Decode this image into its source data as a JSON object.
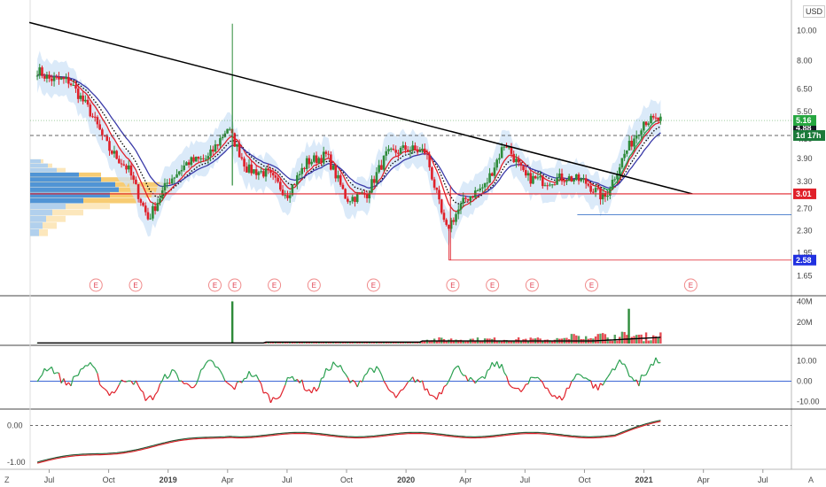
{
  "currency": "USD",
  "corner_left": "Z",
  "corner_right": "A",
  "price_tags": [
    {
      "label": "4.88",
      "value": 4.88,
      "bg": "#131722",
      "fg": "#ffffff"
    },
    {
      "label": "5.16",
      "value": 5.16,
      "bg": "#26a640",
      "fg": "#ffffff"
    },
    {
      "label": "1d 17h",
      "value": 4.62,
      "bg": "#1b7a3a",
      "fg": "#ffffff"
    },
    {
      "label": "3.01",
      "value": 3.01,
      "bg": "#e0202a",
      "fg": "#ffffff"
    },
    {
      "label": "2.58",
      "value": 1.85,
      "bg": "#2030e0",
      "fg": "#ffffff"
    }
  ],
  "earnings_marker": "E",
  "colors": {
    "up": "#2e8b3a",
    "down": "#e0202a",
    "ema_fast": "#e0202a",
    "ema_slow": "#3a3aa8",
    "band": "#cfe3f7",
    "trend": "#000000",
    "support": "#e0202a",
    "ma_green": "#2aa050"
  },
  "chart_data": [
    {
      "type": "candlestick",
      "ylabel": "",
      "scale": "log",
      "y_ticks": [
        "10.00",
        "8.00",
        "6.50",
        "5.50",
        "4.50",
        "3.90",
        "3.30",
        "2.70",
        "2.30",
        "1.95",
        "1.65"
      ],
      "y_tick_values": [
        10.0,
        8.0,
        6.5,
        5.5,
        4.5,
        3.9,
        3.3,
        2.7,
        2.3,
        1.95,
        1.65
      ],
      "ylim": [
        1.5,
        12.5
      ],
      "x_ticks": [
        "Jul",
        "Oct",
        "2019",
        "Apr",
        "Jul",
        "Oct",
        "2020",
        "Apr",
        "Jul",
        "Oct",
        "2021",
        "Apr",
        "Jul"
      ],
      "close_points": [
        {
          "x": "2018-06",
          "y": 7.8
        },
        {
          "x": "2018-07",
          "y": 7.0
        },
        {
          "x": "2018-08",
          "y": 6.9
        },
        {
          "x": "2018-09",
          "y": 5.6
        },
        {
          "x": "2018-10",
          "y": 4.2
        },
        {
          "x": "2018-11",
          "y": 3.6
        },
        {
          "x": "2018-12",
          "y": 2.5
        },
        {
          "x": "2019-01",
          "y": 3.3
        },
        {
          "x": "2019-02",
          "y": 3.8
        },
        {
          "x": "2019-03",
          "y": 3.9
        },
        {
          "x": "2019-04",
          "y": 4.9
        },
        {
          "x": "2019-05",
          "y": 3.6
        },
        {
          "x": "2019-06",
          "y": 3.5
        },
        {
          "x": "2019-07",
          "y": 3.0
        },
        {
          "x": "2019-08",
          "y": 3.8
        },
        {
          "x": "2019-09",
          "y": 4.0
        },
        {
          "x": "2019-10",
          "y": 2.9
        },
        {
          "x": "2019-11",
          "y": 3.0
        },
        {
          "x": "2019-12",
          "y": 4.0
        },
        {
          "x": "2020-01",
          "y": 4.2
        },
        {
          "x": "2020-02",
          "y": 4.1
        },
        {
          "x": "2020-03",
          "y": 2.3
        },
        {
          "x": "2020-04",
          "y": 2.9
        },
        {
          "x": "2020-05",
          "y": 3.2
        },
        {
          "x": "2020-06",
          "y": 4.4
        },
        {
          "x": "2020-07",
          "y": 3.4
        },
        {
          "x": "2020-08",
          "y": 3.3
        },
        {
          "x": "2020-09",
          "y": 3.4
        },
        {
          "x": "2020-10",
          "y": 3.3
        },
        {
          "x": "2020-11",
          "y": 2.9
        },
        {
          "x": "2020-12",
          "y": 4.0
        },
        {
          "x": "2021-01",
          "y": 5.16
        }
      ],
      "trendline": [
        {
          "x": "2018-06",
          "y": 10.6
        },
        {
          "x": "2021-03",
          "y": 3.01
        }
      ],
      "horizontal_levels": [
        3.01,
        2.58,
        1.85,
        4.62,
        5.16
      ],
      "earnings_dates": [
        "2018-09",
        "2018-11",
        "2019-03",
        "2019-04",
        "2019-06",
        "2019-08",
        "2019-11",
        "2020-03",
        "2020-05",
        "2020-07",
        "2020-10",
        "2021-03"
      ]
    },
    {
      "type": "bar",
      "name": "volume",
      "y_ticks": [
        "40M",
        "20M"
      ],
      "y_tick_values": [
        40,
        20
      ],
      "ylim": [
        0,
        42
      ],
      "spikes": [
        {
          "x": "2019-04",
          "y": 40
        },
        {
          "x": "2020-12",
          "y": 33
        }
      ]
    },
    {
      "type": "line",
      "name": "oscillator",
      "y_ticks": [
        "10.00",
        "0.00",
        "-10.00"
      ],
      "y_tick_values": [
        10,
        0,
        -10
      ],
      "ylim": [
        -12,
        16
      ],
      "zero_line": 0
    },
    {
      "type": "line",
      "name": "trend-strength",
      "y_ticks": [
        "0.00",
        "-1.00"
      ],
      "y_tick_values": [
        0,
        -1
      ],
      "ylim": [
        -1.1,
        0.3
      ]
    }
  ]
}
